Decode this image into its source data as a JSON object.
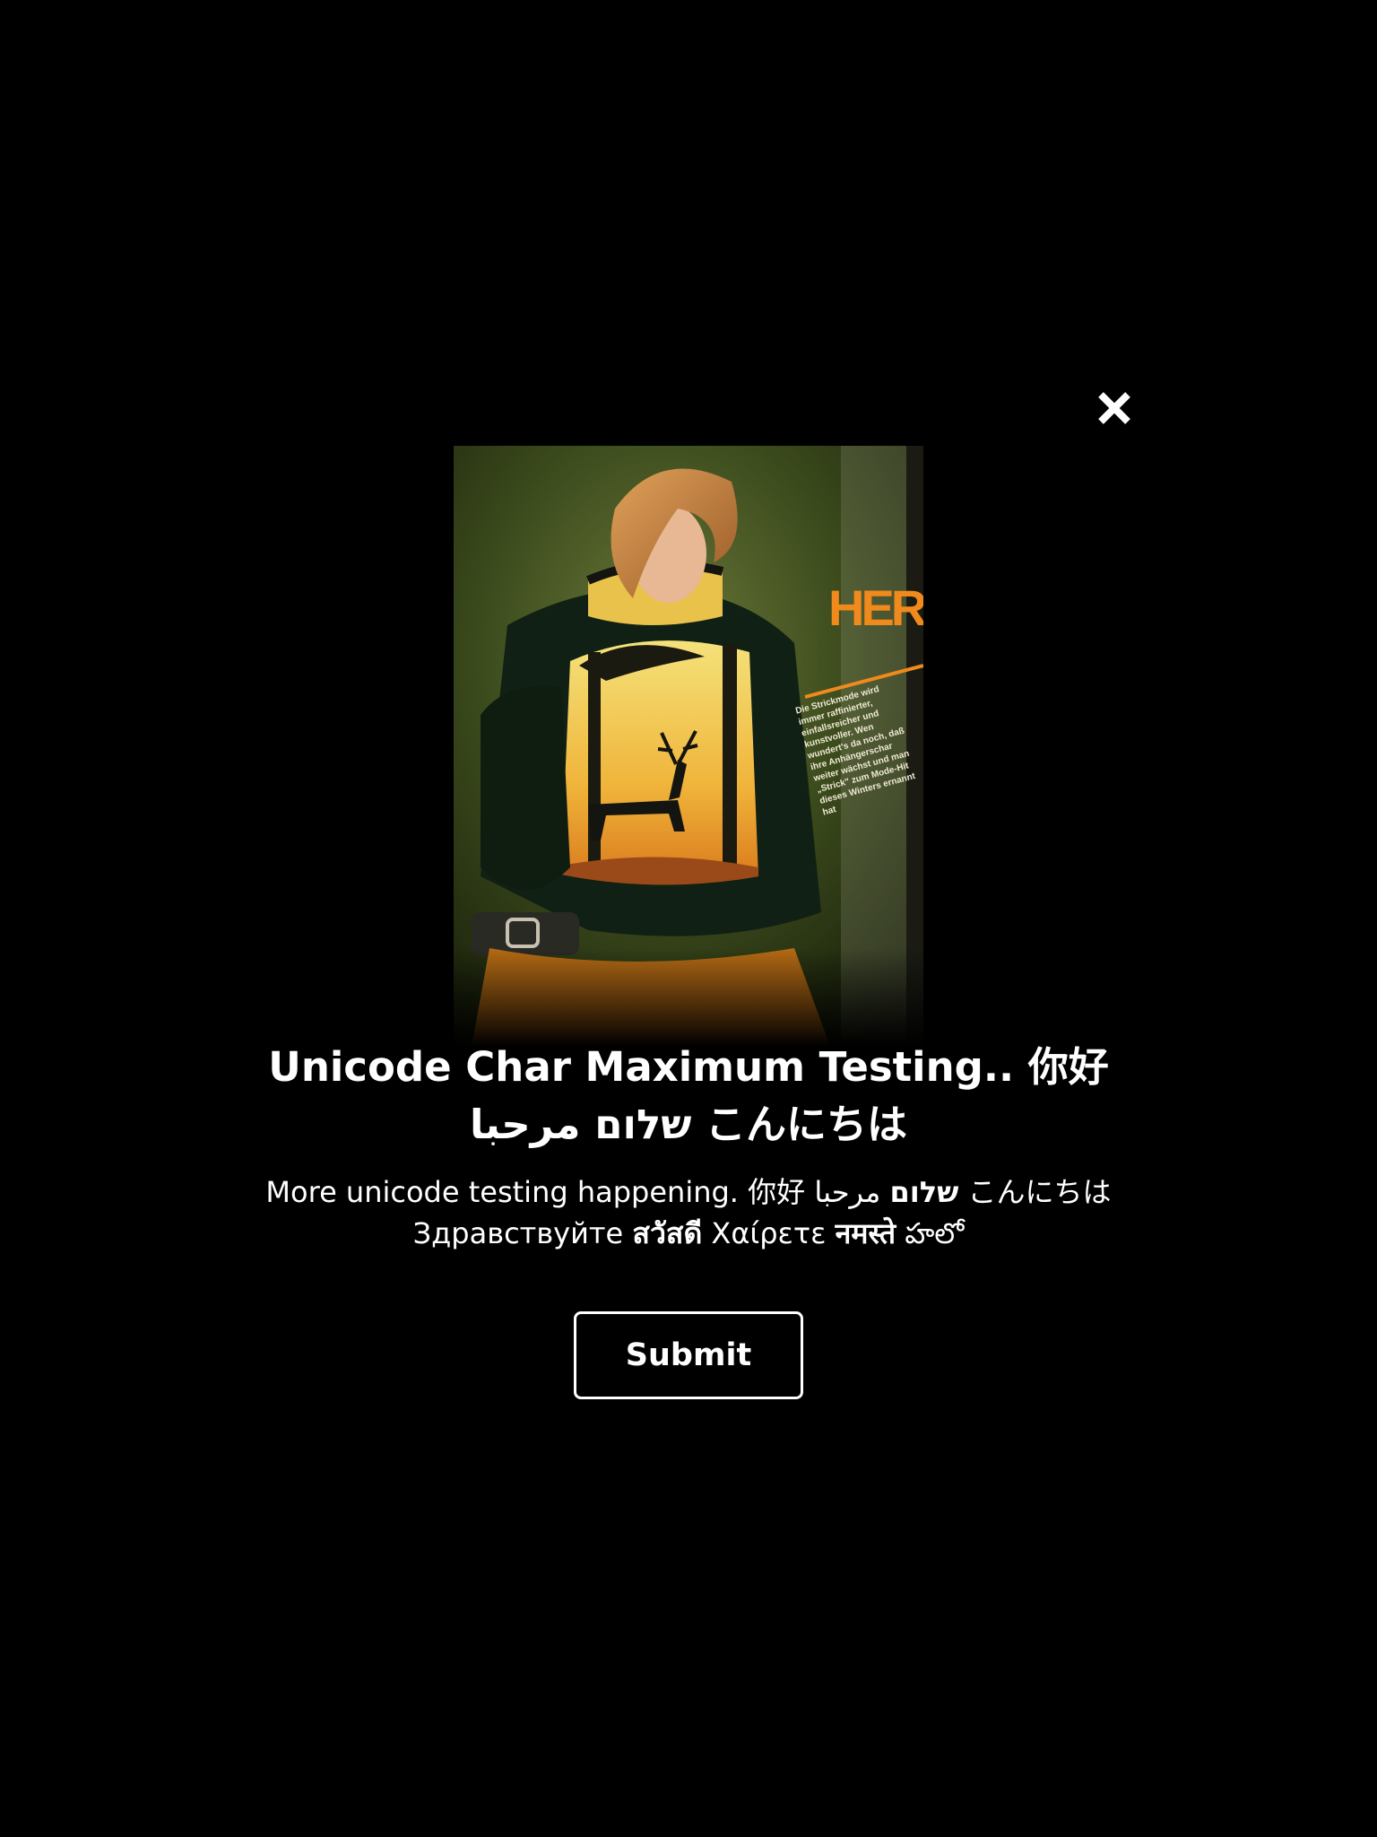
{
  "modal": {
    "close_icon": "close-icon",
    "hero_image": {
      "overlay_heading": "HER",
      "overlay_text": "Die Strickmode wird immer raffinierter, einfallsreicher und kunstvoller. Wen wundert's da noch, daß ihre Anhängerschar weiter wächst und man „Strick\" zum Mode-Hit dieses Winters ernannt hat"
    },
    "title_line1": "Unicode Char Maximum Testing.. 你好",
    "title_line2": "שלום مرحبا こんにちは",
    "description": {
      "line1_part1": "More unicode testing happening. 你好 ",
      "line1_bold1": "שלום",
      "line1_part2": " مرحبا こんにちは",
      "line2_part1": "Здравствуйте ",
      "line2_bold1": "สวัสดี",
      "line2_part2": " Χαίρετε ",
      "line2_bold2": "नमस्ते",
      "line2_part3": " హలో"
    },
    "submit_label": "Submit"
  },
  "colors": {
    "background": "#000000",
    "text": "#ffffff",
    "accent_orange": "#f08a1c"
  }
}
